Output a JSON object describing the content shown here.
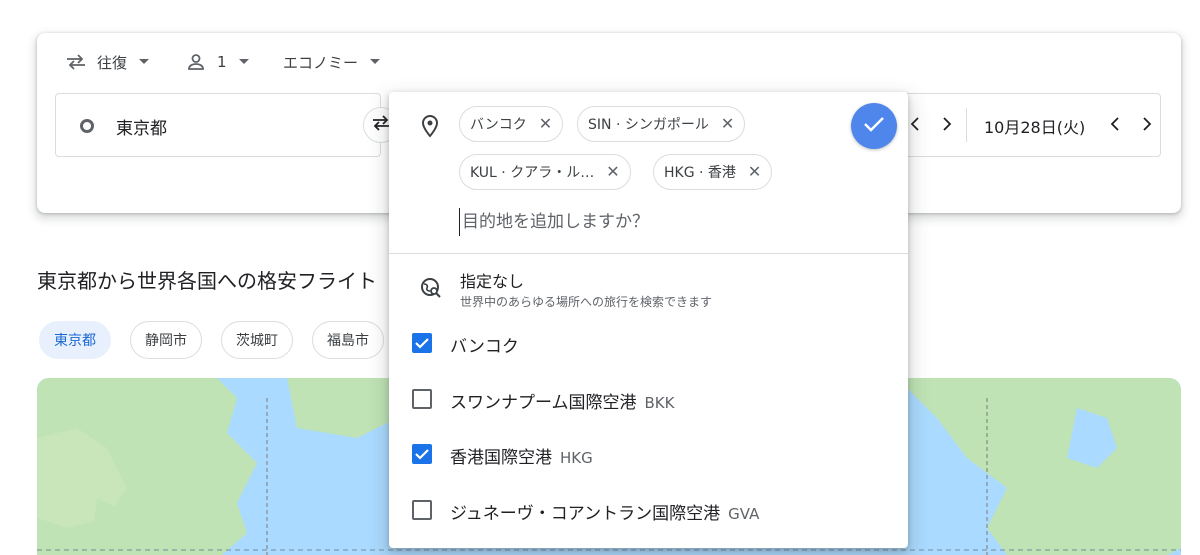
{
  "search": {
    "trip_type": "往復",
    "passengers": "1",
    "cabin": "エコノミー",
    "origin": "東京都",
    "return_date": "10月28日(火)"
  },
  "heading": "東京都から世界各国への格安フライト",
  "chips": [
    "東京都",
    "静岡市",
    "茨城町",
    "福島市"
  ],
  "destination_panel": {
    "tags": [
      "バンコク",
      "SIN · シンガポール",
      "KUL · クアラ・ル…",
      "HKG · 香港"
    ],
    "add_placeholder": "目的地を追加しますか？",
    "no_preference": {
      "title": "指定なし",
      "subtitle": "世界中のあらゆる場所への旅行を検索できます"
    },
    "options": [
      {
        "label": "バンコク",
        "code": "",
        "checked": true
      },
      {
        "label": "スワンナプーム国際空港",
        "code": "BKK",
        "checked": false
      },
      {
        "label": "香港国際空港",
        "code": "HKG",
        "checked": true
      },
      {
        "label": "ジュネーヴ・コアントラン国際空港",
        "code": "GVA",
        "checked": false
      }
    ]
  },
  "colors": {
    "accent": "#1a73e8",
    "confirm_button": "#4f86ec",
    "active_chip_bg": "#e8f0fe",
    "map_water": "#aadaff",
    "map_land": "#bfe3b4"
  },
  "icons": [
    "swap-icon",
    "caret-down-icon",
    "person-icon",
    "origin-ring-icon",
    "location-pin-icon",
    "close-icon",
    "check-icon",
    "globe-search-icon",
    "chevron-left-icon",
    "chevron-right-icon"
  ]
}
